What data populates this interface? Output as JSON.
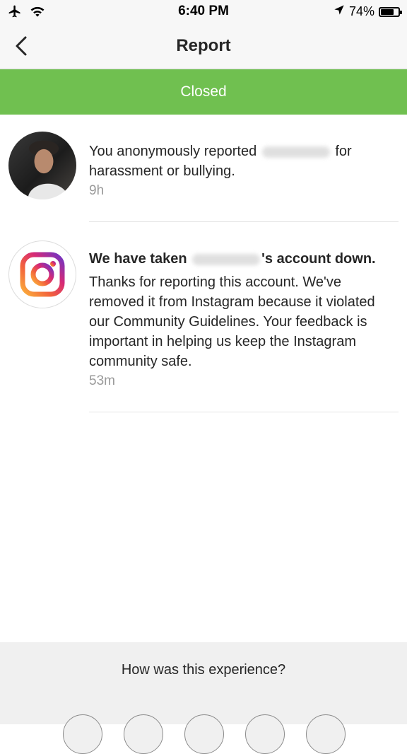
{
  "status_bar": {
    "time": "6:40 PM",
    "battery_percent": "74%",
    "battery_level": 0.74,
    "icons": [
      "airplane-icon",
      "wifi-icon",
      "location-arrow-icon",
      "battery-icon"
    ]
  },
  "nav": {
    "title": "Report",
    "back_icon": "chevron-left-icon"
  },
  "banner": {
    "label": "Closed",
    "color": "#70c050"
  },
  "items": [
    {
      "text_before": "You anonymously reported",
      "text_after": "for harassment or bullying.",
      "time": "9h"
    },
    {
      "headline_before": "We have taken",
      "headline_after": "'s account down.",
      "body": "Thanks for reporting this account. We've removed it from Instagram because it violated our Community Guidelines. Your feedback is important in helping us keep the Instagram community safe.",
      "time": "53m",
      "icon": "instagram-logo-icon"
    }
  ],
  "feedback": {
    "question": "How was this experience?",
    "options_count": 5
  }
}
